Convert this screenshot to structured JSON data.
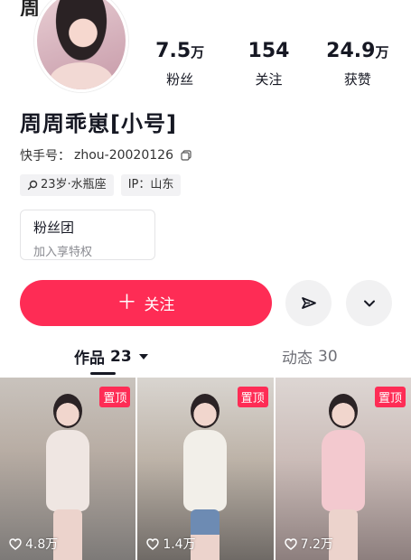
{
  "header": {
    "cut_title": "周"
  },
  "profile": {
    "nickname": "周周乖崽[小号]",
    "uid_label": "快手号：",
    "uid_value": "zhou-20020126",
    "tags": [
      {
        "icon": "search-icon",
        "text": "23岁·水瓶座"
      },
      {
        "icon": "",
        "text": "IP：山东"
      }
    ]
  },
  "stats": [
    {
      "num": "7.5",
      "unit": "万",
      "label": "粉丝"
    },
    {
      "num": "154",
      "unit": "",
      "label": "关注"
    },
    {
      "num": "24.9",
      "unit": "万",
      "label": "获赞"
    }
  ],
  "fan_group": {
    "title": "粉丝团",
    "subtitle": "加入享特权"
  },
  "actions": {
    "follow_plus": "＋",
    "follow_label": "关注"
  },
  "tabs": {
    "works_label": "作品",
    "works_count": "23",
    "dynamic_label": "动态",
    "dynamic_count": "30"
  },
  "videos": [
    {
      "pin_label": "置顶",
      "likes": "4.8万"
    },
    {
      "pin_label": "置顶",
      "likes": "1.4万"
    },
    {
      "pin_label": "置顶",
      "likes": "7.2万"
    }
  ],
  "colors": {
    "accent": "#fe2c55",
    "text": "#161823",
    "muted": "#8a8b91"
  }
}
